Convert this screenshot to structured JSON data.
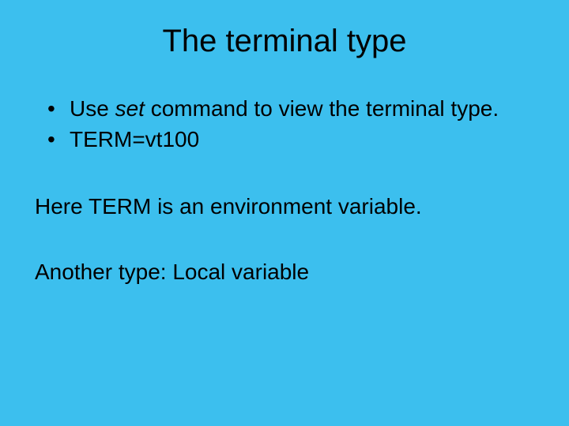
{
  "slide": {
    "title": "The terminal type",
    "bullet1_prefix": "Use ",
    "bullet1_italic": "set",
    "bullet1_suffix": " command to view the terminal type.",
    "bullet2": "TERM=vt100",
    "para1": "Here TERM is an environment variable.",
    "para2": "Another type: Local variable"
  }
}
